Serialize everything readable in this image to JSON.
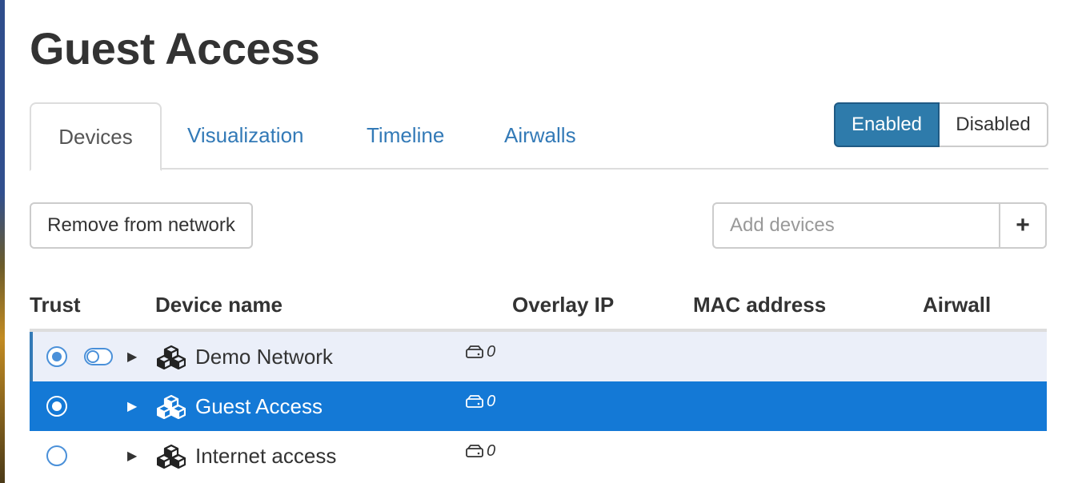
{
  "page": {
    "title": "Guest Access"
  },
  "tabs": [
    {
      "label": "Devices",
      "active": true
    },
    {
      "label": "Visualization",
      "active": false
    },
    {
      "label": "Timeline",
      "active": false
    },
    {
      "label": "Airwalls",
      "active": false
    }
  ],
  "status_toggle": {
    "enabled_label": "Enabled",
    "disabled_label": "Disabled",
    "selected": "Enabled"
  },
  "toolbar": {
    "remove_label": "Remove from network",
    "add_placeholder": "Add devices",
    "add_button": "+"
  },
  "table": {
    "columns": [
      "Trust",
      "Device name",
      "Overlay IP",
      "MAC address",
      "Airwall"
    ],
    "rows": [
      {
        "name": "Demo Network",
        "count": "0",
        "trust": "selected",
        "state": "hover"
      },
      {
        "name": "Guest Access",
        "count": "0",
        "trust": "selected",
        "state": "selected"
      },
      {
        "name": "Internet access",
        "count": "0",
        "trust": "unselected",
        "state": "normal"
      }
    ]
  },
  "colors": {
    "accent": "#337ab7",
    "selected_row": "#1479d6",
    "hover_row": "#ebeff9"
  }
}
